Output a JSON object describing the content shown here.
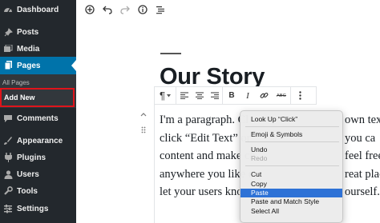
{
  "sidebar": {
    "dashboard": "Dashboard",
    "posts": "Posts",
    "media": "Media",
    "pages": "Pages",
    "submenu_all_pages": "All Pages",
    "submenu_add_new": "Add New",
    "comments": "Comments",
    "appearance": "Appearance",
    "plugins": "Plugins",
    "users": "Users",
    "tools": "Tools",
    "settings": "Settings"
  },
  "topbar_icons": [
    "add-block-icon",
    "undo-icon",
    "redo-icon",
    "info-icon",
    "outline-icon"
  ],
  "editor": {
    "title": "Our Story",
    "paragraph_lines": [
      "I'm a paragraph. Cl",
      "click “Edit Text” or",
      "content and make ch",
      "anywhere you like o",
      "let your users know"
    ],
    "paragraph_tail_lines": [
      "own tex",
      "you ca",
      "feel free",
      "reat plac",
      "ourself."
    ]
  },
  "block_toolbar": {
    "paragraph_symbol": "¶",
    "bold": "B",
    "italic": "I",
    "strikethrough_label": "ABC"
  },
  "context_menu": {
    "look_up": "Look Up “Click”",
    "emoji": "Emoji & Symbols",
    "undo": "Undo",
    "redo": "Redo",
    "cut": "Cut",
    "copy": "Copy",
    "paste": "Paste",
    "paste_match": "Paste and Match Style",
    "select_all": "Select All"
  },
  "colors": {
    "sidebar_bg": "#23282d",
    "active_menu": "#0073aa",
    "highlight_box": "#e0141b",
    "menu_selection": "#2e72d6"
  }
}
